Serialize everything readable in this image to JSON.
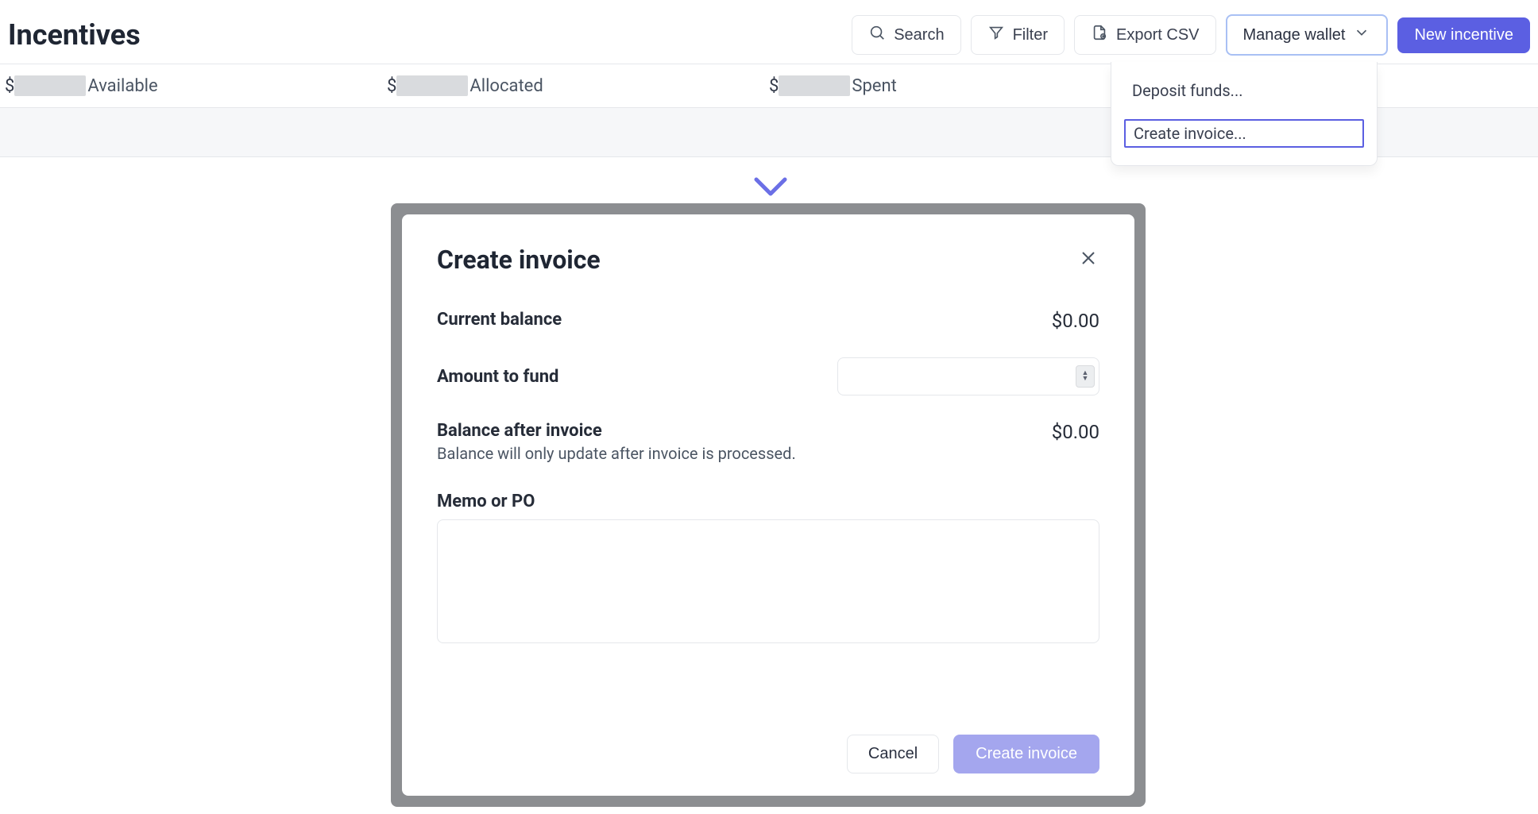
{
  "header": {
    "title": "Incentives",
    "search": "Search",
    "filter": "Filter",
    "export": "Export CSV",
    "manage_wallet": "Manage wallet",
    "new_incentive": "New incentive"
  },
  "summary": {
    "available": "Available",
    "allocated": "Allocated",
    "spent": "Spent",
    "currency": "$"
  },
  "dropdown": {
    "deposit": "Deposit funds...",
    "create_invoice": "Create invoice..."
  },
  "modal": {
    "title": "Create invoice",
    "current_balance_label": "Current balance",
    "current_balance_value": "$0.00",
    "amount_to_fund_label": "Amount to fund",
    "amount_to_fund_value": "",
    "balance_after_label": "Balance after invoice",
    "balance_after_sub": "Balance will only update after invoice is processed.",
    "balance_after_value": "$0.00",
    "memo_label": "Memo or PO",
    "memo_value": "",
    "cancel": "Cancel",
    "create": "Create invoice"
  }
}
